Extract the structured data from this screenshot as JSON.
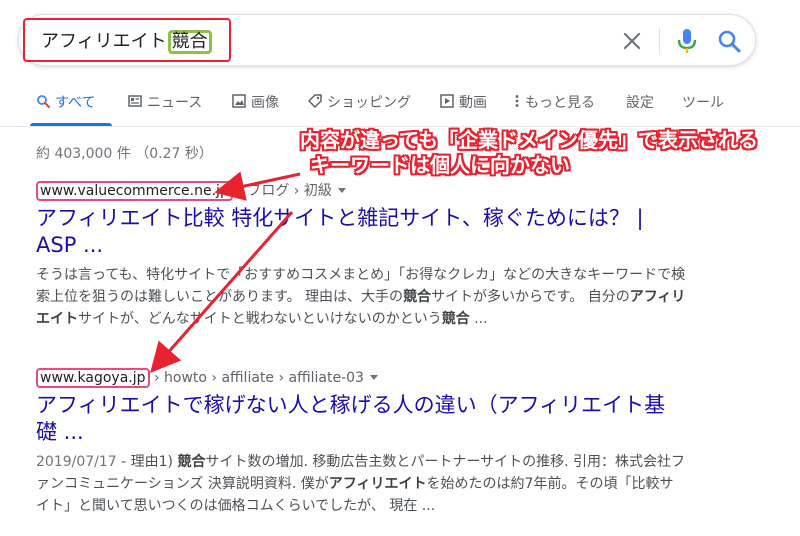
{
  "search": {
    "query_prefix": "アフィリエイト",
    "query_highlight": "競合"
  },
  "tabs": [
    {
      "label": "すべて",
      "icon": "search-icon"
    },
    {
      "label": "ニュース",
      "icon": "news-icon"
    },
    {
      "label": "画像",
      "icon": "image-icon"
    },
    {
      "label": "ショッピング",
      "icon": "tag-icon"
    },
    {
      "label": "動画",
      "icon": "play-icon"
    },
    {
      "label": "もっと見る",
      "icon": "more-vert-icon"
    },
    {
      "label": "設定"
    },
    {
      "label": "ツール"
    }
  ],
  "stats": "約 403,000 件 （0.27 秒）",
  "annotation": {
    "line1": "内容が違っても「企業ドメイン優先」で表示される",
    "line2": "キーワードは個人に向かない"
  },
  "results": [
    {
      "domain": "www.valuecommerce.ne.jp",
      "path": " › ブログ › 初級",
      "title": "アフィリエイト比較 特化サイトと雑記サイト、稼ぐためには？ | ASP ...",
      "snippet": [
        {
          "t": "そうは言っても、特化サイトで「おすすめコスメまとめ」「お得なクレカ」などの大きなキーワードで検索上位を狙うのは難しいことがあります。 理由は、大手の"
        },
        {
          "t": "競合",
          "b": true
        },
        {
          "t": "サイトが多いからです。 自分の"
        },
        {
          "t": "アフィリエイト",
          "b": true
        },
        {
          "t": "サイトが、どんなサイトと戦わないといけないのかという"
        },
        {
          "t": "競合",
          "b": true
        },
        {
          "t": " ..."
        }
      ]
    },
    {
      "domain": "www.kagoya.jp",
      "path": " › howto › affiliate › affiliate-03",
      "title": "アフィリエイトで稼げない人と稼げる人の違い（アフィリエイト基礎 ...",
      "date": "2019/07/17",
      "snippet": [
        {
          "t": " - 理由1) "
        },
        {
          "t": "競合",
          "b": true
        },
        {
          "t": "サイト数の増加. 移動広告主数とパートナーサイトの推移. 引用：株式会社ファンコミュニケーションズ 決算説明資料. 僕が"
        },
        {
          "t": "アフィリエイト",
          "b": true
        },
        {
          "t": "を始めたのは約7年前。その頃「比較サイト」と聞いて思いつくのは価格コムくらいでしたが、 現在 ..."
        }
      ]
    }
  ],
  "colors": {
    "annotation_red": "#e8222e",
    "domain_box": "#e84a7a",
    "query_highlight": "#8bc34a",
    "link": "#1a0dab",
    "accent": "#1a73e8"
  }
}
